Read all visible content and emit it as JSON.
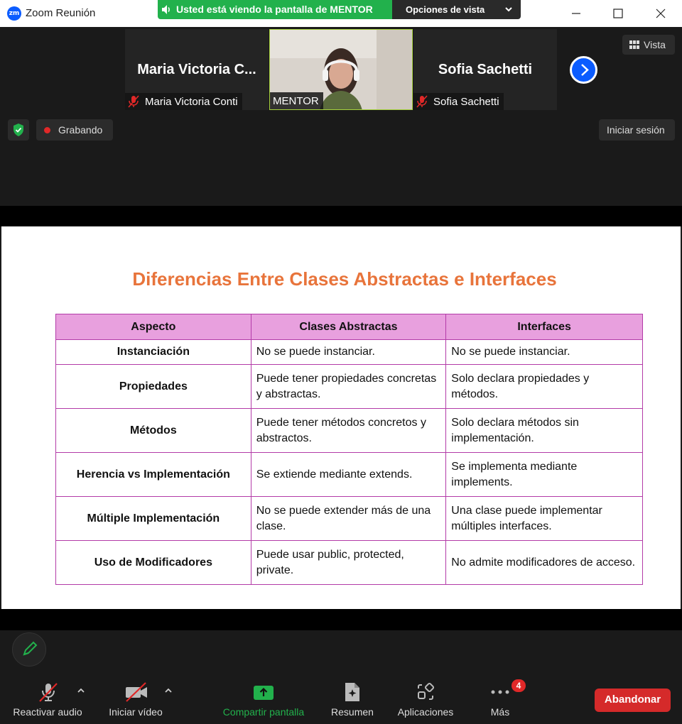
{
  "window": {
    "title": "Zoom Reunión",
    "logo_text": "zm"
  },
  "share_banner": {
    "text": "Usted está viendo la pantalla de MENTOR",
    "view_options_label": "Opciones de vista"
  },
  "gallery": {
    "participants": [
      {
        "display_name": "Maria Victoria C...",
        "name_tag": "Maria Victoria Conti",
        "muted": true
      },
      {
        "display_name": "",
        "name_tag": "MENTOR",
        "muted": false,
        "video_on": true
      },
      {
        "display_name": "Sofia Sachetti",
        "name_tag": "Sofia Sachetti",
        "muted": true
      }
    ],
    "view_label": "Vista",
    "recording_label": "Grabando",
    "signin_label": "Iniciar sesión"
  },
  "slide": {
    "title": "Diferencias Entre Clases Abstractas e Interfaces",
    "headers": [
      "Aspecto",
      "Clases Abstractas",
      "Interfaces"
    ],
    "rows": [
      [
        "Instanciación",
        "No se puede instanciar.",
        "No se puede instanciar."
      ],
      [
        "Propiedades",
        "Puede tener propiedades concretas y abstractas.",
        "Solo declara propiedades y métodos."
      ],
      [
        "Métodos",
        "Puede tener métodos concretos y abstractos.",
        "Solo declara métodos sin implementación."
      ],
      [
        "Herencia vs Implementación",
        "Se extiende mediante extends.",
        "Se implementa mediante implements."
      ],
      [
        "Múltiple Implementación",
        "No se puede extender más de una clase.",
        "Una clase puede implementar múltiples interfaces."
      ],
      [
        "Uso de Modificadores",
        "Puede usar public, protected, private.",
        "No admite modificadores de acceso."
      ]
    ],
    "colors": {
      "title": "#e8743b",
      "header_bg": "#e8a0de",
      "border": "#b33ba8"
    }
  },
  "toolbar": {
    "audio_label": "Reactivar audio",
    "video_label": "Iniciar vídeo",
    "share_label": "Compartir pantalla",
    "summary_label": "Resumen",
    "apps_label": "Aplicaciones",
    "more_label": "Más",
    "more_badge": "4",
    "leave_label": "Abandonar",
    "colors": {
      "share": "#22b14c",
      "leave": "#d52a2a"
    }
  }
}
